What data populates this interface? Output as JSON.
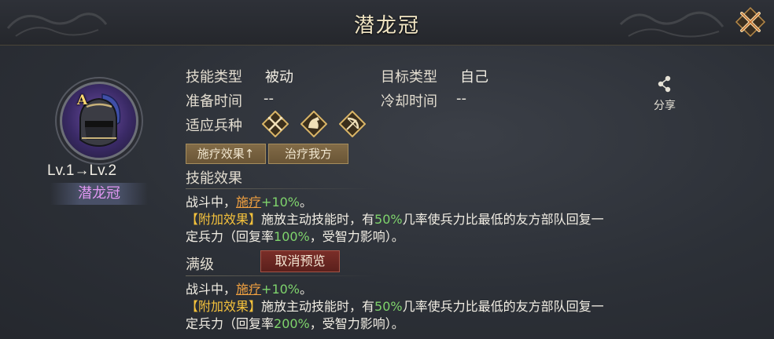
{
  "header": {
    "title": "潜龙冠"
  },
  "hero": {
    "grade": "A",
    "level_text": "Lv.1→Lv.2",
    "name": "潜龙冠"
  },
  "info": {
    "skill_type_label": "技能类型",
    "skill_type_value": "被动",
    "target_type_label": "目标类型",
    "target_type_value": "自己",
    "prep_time_label": "准备时间",
    "prep_time_value": "--",
    "cooldown_label": "冷却时间",
    "cooldown_value": "--",
    "troop_label": "适应兵种",
    "troop_icons": [
      "crossed-spears-icon",
      "cavalry-horse-icon",
      "bow-icon"
    ]
  },
  "share": {
    "label": "分享"
  },
  "tags": [
    "施疗效果↑",
    "治疗我方"
  ],
  "current": {
    "title": "技能效果",
    "l1_a": "战斗中，",
    "l1_heal": "施疗",
    "l1_num": "+10%",
    "l1_end": "。",
    "l2_tag": "【附加效果】",
    "l2_a": "施放主动技能时，有",
    "l2_num": "50%",
    "l2_b": "几率使兵力比最低的友方部队回复一",
    "l3_a": "定兵力（回复率",
    "l3_num": "100%",
    "l3_b": "，受智力影响）。"
  },
  "max": {
    "title": "满级",
    "cancel_label": "取消预览",
    "l1_a": "战斗中，",
    "l1_heal": "施疗",
    "l1_num": "+10%",
    "l1_end": "。",
    "l2_tag": "【附加效果】",
    "l2_a": "施放主动技能时，有",
    "l2_num": "50%",
    "l2_b": "几率使兵力比最低的友方部队回复一",
    "l3_a": "定兵力（回复率",
    "l3_num": "200%",
    "l3_b": "，受智力影响）。"
  },
  "colors": {
    "heal": "#f0a040",
    "number": "#7fd46c",
    "bonus_tag": "#f5c23c",
    "name": "#e197f2"
  }
}
